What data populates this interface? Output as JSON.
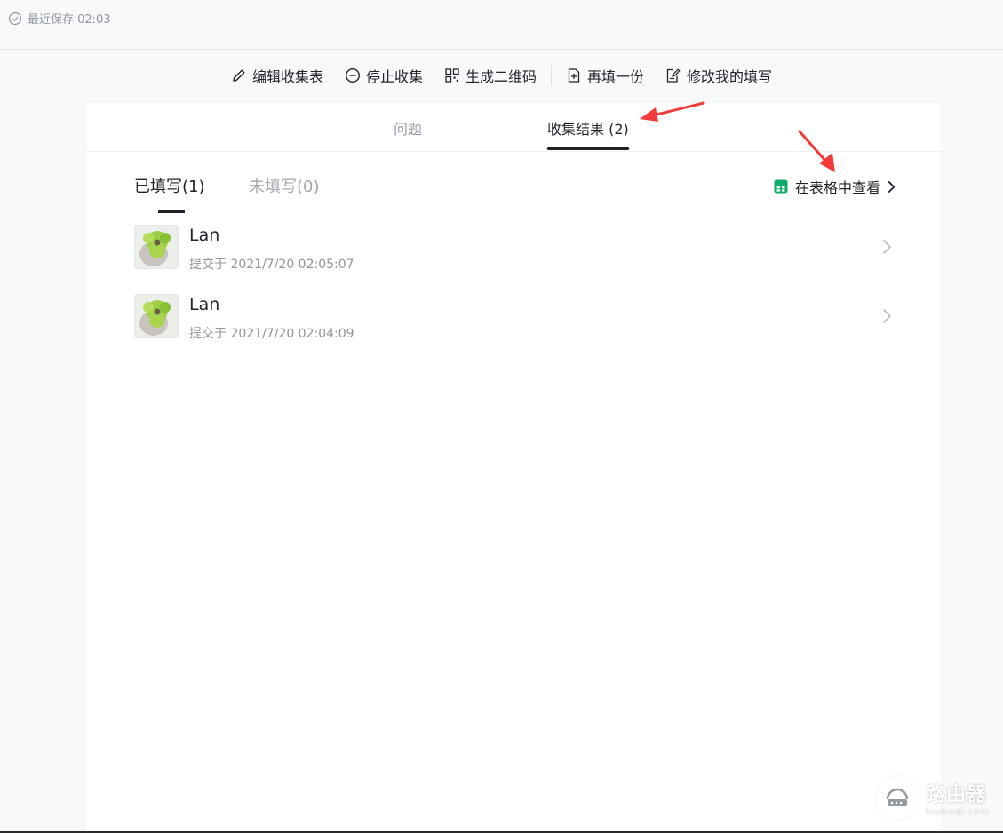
{
  "status": {
    "save_text": "最近保存 02:03"
  },
  "toolbar": {
    "edit_label": "编辑收集表",
    "stop_label": "停止收集",
    "qrcode_label": "生成二维码",
    "refill_label": "再填一份",
    "modify_label": "修改我的填写"
  },
  "tabs": {
    "questions_label": "问题",
    "results_label": "收集结果 (2)"
  },
  "subtabs": {
    "filled_label": "已填写(1)",
    "unfilled_label": "未填写(0)"
  },
  "view_in_sheet_label": "在表格中查看",
  "responses": [
    {
      "name": "Lan",
      "time": "提交于 2021/7/20 02:05:07"
    },
    {
      "name": "Lan",
      "time": "提交于 2021/7/20 02:04:09"
    }
  ],
  "watermark": {
    "cn": "路由器",
    "en": "luyouqi.com"
  },
  "colors": {
    "accent": "#1f2329",
    "sheet_green": "#0fa968",
    "annotation_red": "#f23b3b"
  },
  "icons": [
    "check-circle-icon",
    "pencil-icon",
    "minus-circle-icon",
    "qrcode-icon",
    "plus-square-icon",
    "edit-note-icon",
    "sheet-icon",
    "chevron-right-icon"
  ]
}
